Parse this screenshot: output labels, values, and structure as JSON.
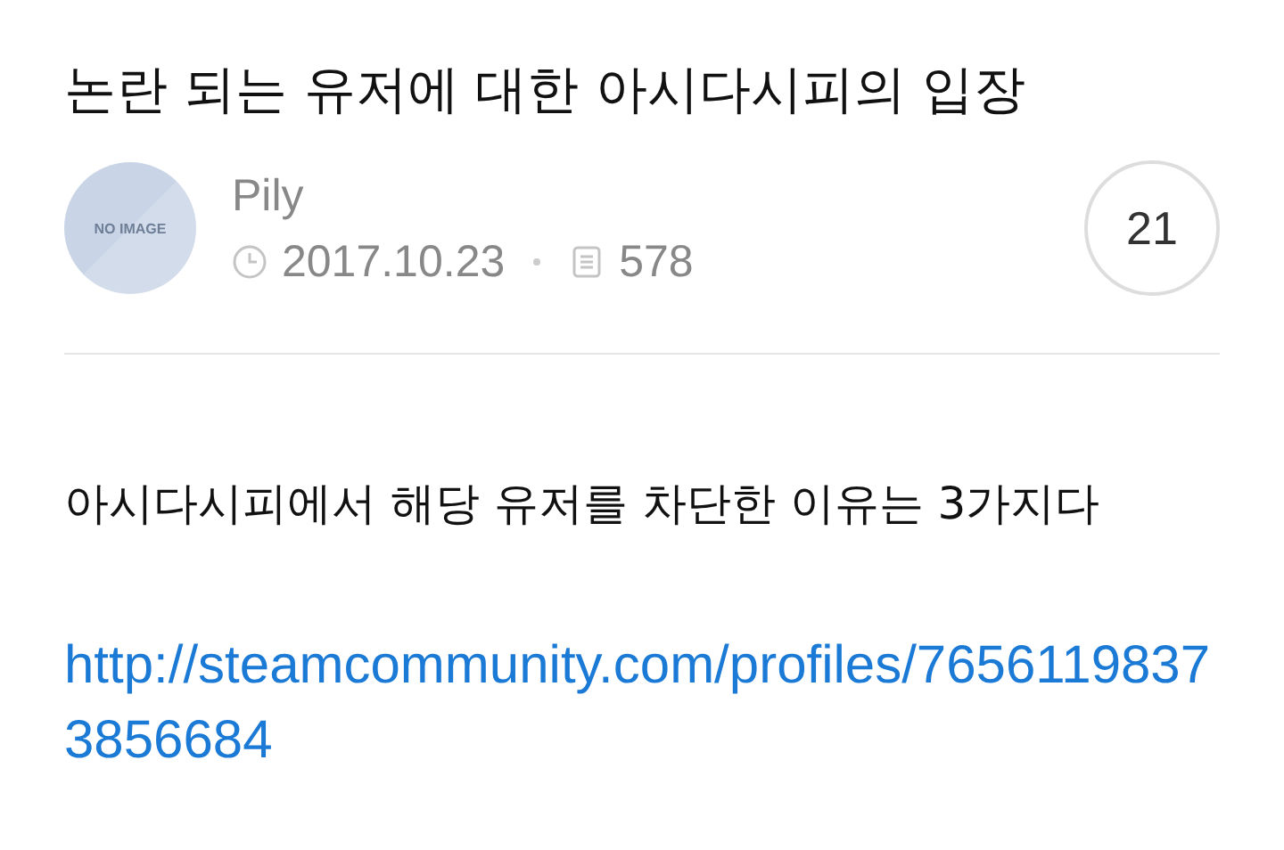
{
  "post": {
    "title": "논란 되는 유저에 대한 아시다시피의 입장",
    "avatar_text": "NO IMAGE",
    "author": "Pily",
    "date": "2017.10.23",
    "views": "578",
    "comments": "21"
  },
  "body": [
    {
      "kind": "text",
      "text": "아시다시피에서 해당 유저를 차단한 이유는 3가지다"
    },
    {
      "kind": "link",
      "text": "http://steamcommunity.com/profiles/76561198373856684"
    }
  ]
}
